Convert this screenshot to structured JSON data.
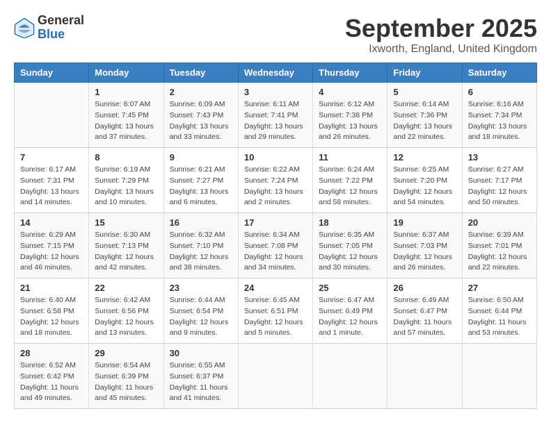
{
  "logo": {
    "general": "General",
    "blue": "Blue"
  },
  "header": {
    "month": "September 2025",
    "location": "Ixworth, England, United Kingdom"
  },
  "days_of_week": [
    "Sunday",
    "Monday",
    "Tuesday",
    "Wednesday",
    "Thursday",
    "Friday",
    "Saturday"
  ],
  "weeks": [
    [
      {
        "day": "",
        "info": ""
      },
      {
        "day": "1",
        "info": "Sunrise: 6:07 AM\nSunset: 7:45 PM\nDaylight: 13 hours\nand 37 minutes."
      },
      {
        "day": "2",
        "info": "Sunrise: 6:09 AM\nSunset: 7:43 PM\nDaylight: 13 hours\nand 33 minutes."
      },
      {
        "day": "3",
        "info": "Sunrise: 6:11 AM\nSunset: 7:41 PM\nDaylight: 13 hours\nand 29 minutes."
      },
      {
        "day": "4",
        "info": "Sunrise: 6:12 AM\nSunset: 7:38 PM\nDaylight: 13 hours\nand 26 minutes."
      },
      {
        "day": "5",
        "info": "Sunrise: 6:14 AM\nSunset: 7:36 PM\nDaylight: 13 hours\nand 22 minutes."
      },
      {
        "day": "6",
        "info": "Sunrise: 6:16 AM\nSunset: 7:34 PM\nDaylight: 13 hours\nand 18 minutes."
      }
    ],
    [
      {
        "day": "7",
        "info": "Sunrise: 6:17 AM\nSunset: 7:31 PM\nDaylight: 13 hours\nand 14 minutes."
      },
      {
        "day": "8",
        "info": "Sunrise: 6:19 AM\nSunset: 7:29 PM\nDaylight: 13 hours\nand 10 minutes."
      },
      {
        "day": "9",
        "info": "Sunrise: 6:21 AM\nSunset: 7:27 PM\nDaylight: 13 hours\nand 6 minutes."
      },
      {
        "day": "10",
        "info": "Sunrise: 6:22 AM\nSunset: 7:24 PM\nDaylight: 13 hours\nand 2 minutes."
      },
      {
        "day": "11",
        "info": "Sunrise: 6:24 AM\nSunset: 7:22 PM\nDaylight: 12 hours\nand 58 minutes."
      },
      {
        "day": "12",
        "info": "Sunrise: 6:25 AM\nSunset: 7:20 PM\nDaylight: 12 hours\nand 54 minutes."
      },
      {
        "day": "13",
        "info": "Sunrise: 6:27 AM\nSunset: 7:17 PM\nDaylight: 12 hours\nand 50 minutes."
      }
    ],
    [
      {
        "day": "14",
        "info": "Sunrise: 6:29 AM\nSunset: 7:15 PM\nDaylight: 12 hours\nand 46 minutes."
      },
      {
        "day": "15",
        "info": "Sunrise: 6:30 AM\nSunset: 7:13 PM\nDaylight: 12 hours\nand 42 minutes."
      },
      {
        "day": "16",
        "info": "Sunrise: 6:32 AM\nSunset: 7:10 PM\nDaylight: 12 hours\nand 38 minutes."
      },
      {
        "day": "17",
        "info": "Sunrise: 6:34 AM\nSunset: 7:08 PM\nDaylight: 12 hours\nand 34 minutes."
      },
      {
        "day": "18",
        "info": "Sunrise: 6:35 AM\nSunset: 7:05 PM\nDaylight: 12 hours\nand 30 minutes."
      },
      {
        "day": "19",
        "info": "Sunrise: 6:37 AM\nSunset: 7:03 PM\nDaylight: 12 hours\nand 26 minutes."
      },
      {
        "day": "20",
        "info": "Sunrise: 6:39 AM\nSunset: 7:01 PM\nDaylight: 12 hours\nand 22 minutes."
      }
    ],
    [
      {
        "day": "21",
        "info": "Sunrise: 6:40 AM\nSunset: 6:58 PM\nDaylight: 12 hours\nand 18 minutes."
      },
      {
        "day": "22",
        "info": "Sunrise: 6:42 AM\nSunset: 6:56 PM\nDaylight: 12 hours\nand 13 minutes."
      },
      {
        "day": "23",
        "info": "Sunrise: 6:44 AM\nSunset: 6:54 PM\nDaylight: 12 hours\nand 9 minutes."
      },
      {
        "day": "24",
        "info": "Sunrise: 6:45 AM\nSunset: 6:51 PM\nDaylight: 12 hours\nand 5 minutes."
      },
      {
        "day": "25",
        "info": "Sunrise: 6:47 AM\nSunset: 6:49 PM\nDaylight: 12 hours\nand 1 minute."
      },
      {
        "day": "26",
        "info": "Sunrise: 6:49 AM\nSunset: 6:47 PM\nDaylight: 11 hours\nand 57 minutes."
      },
      {
        "day": "27",
        "info": "Sunrise: 6:50 AM\nSunset: 6:44 PM\nDaylight: 11 hours\nand 53 minutes."
      }
    ],
    [
      {
        "day": "28",
        "info": "Sunrise: 6:52 AM\nSunset: 6:42 PM\nDaylight: 11 hours\nand 49 minutes."
      },
      {
        "day": "29",
        "info": "Sunrise: 6:54 AM\nSunset: 6:39 PM\nDaylight: 11 hours\nand 45 minutes."
      },
      {
        "day": "30",
        "info": "Sunrise: 6:55 AM\nSunset: 6:37 PM\nDaylight: 11 hours\nand 41 minutes."
      },
      {
        "day": "",
        "info": ""
      },
      {
        "day": "",
        "info": ""
      },
      {
        "day": "",
        "info": ""
      },
      {
        "day": "",
        "info": ""
      }
    ]
  ]
}
